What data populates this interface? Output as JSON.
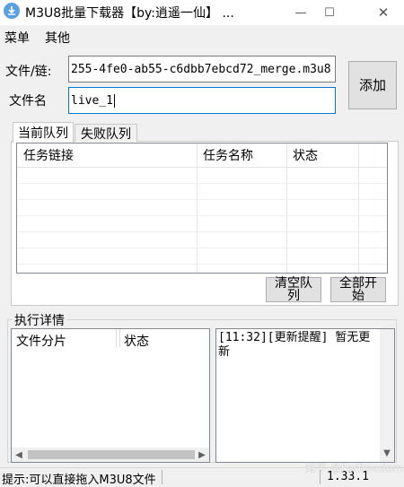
{
  "window": {
    "title": "M3U8批量下载器【by:逍遥一仙】 ...",
    "minimize_glyph": "—",
    "maximize_glyph": "☐",
    "close_glyph": "✕"
  },
  "menu": [
    "菜单",
    "其他"
  ],
  "form": {
    "file_link_label": "文件/链:",
    "file_link_value": "255-4fe0-ab55-c6dbb7ebcd72_merge.m3u8",
    "file_name_label": "文件名",
    "file_name_value": "live_1",
    "add_button": "添加"
  },
  "tabs": [
    {
      "label": "当前队列",
      "active": true
    },
    {
      "label": "失败队列",
      "active": false
    }
  ],
  "queue": {
    "columns": [
      "任务链接",
      "任务名称",
      "状态"
    ],
    "rows": [],
    "clear_button": "清空队\n列",
    "start_all_button": "全部开\n始"
  },
  "details": {
    "title": "执行详情",
    "columns": [
      "文件分片",
      "状态"
    ],
    "log": "[11:32][更新提醒] 暂无更新"
  },
  "status": {
    "hint": "提示:可以直接拖入M3U8文件",
    "version": "1.33.1"
  },
  "watermark": "知乎 @Forfreedom",
  "icons": {
    "app": "download-icon",
    "scroll_left": "arrow-left-icon",
    "scroll_right": "arrow-right-icon",
    "scroll_down": "arrow-down-icon"
  },
  "colors": {
    "focus_border": "#0078d7",
    "app_icon": "#5aa0e0"
  }
}
